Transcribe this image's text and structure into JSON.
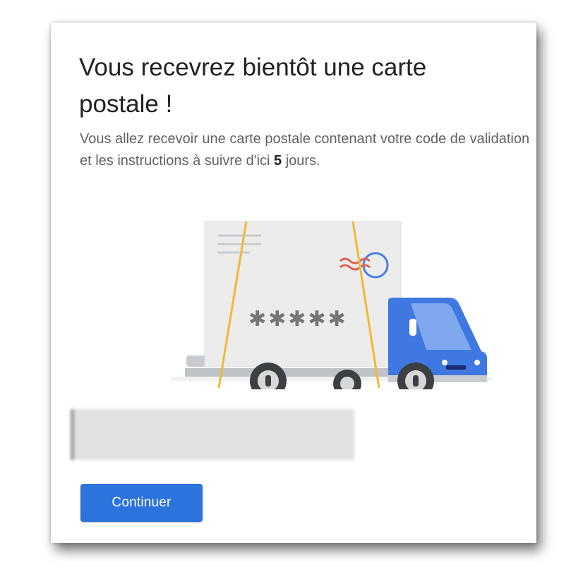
{
  "dialog": {
    "title": "Vous recevrez bientôt une carte postale !",
    "description_before": "Vous allez recevoir une carte postale contenant votre code de validation et les instructions à suivre d'ici ",
    "description_days": "5",
    "description_after": " jours.",
    "postcard_code_mask": "✱✱✱✱✱",
    "continue_label": "Continuer"
  },
  "illustration": {
    "icon": "delivery-truck-postcard-illustration"
  },
  "colors": {
    "button": "#2d73dd",
    "truck_cab": "#3f78e0",
    "strap": "#f2b933",
    "stamp_red": "#e06050",
    "stamp_circle": "#4a7fe4"
  }
}
